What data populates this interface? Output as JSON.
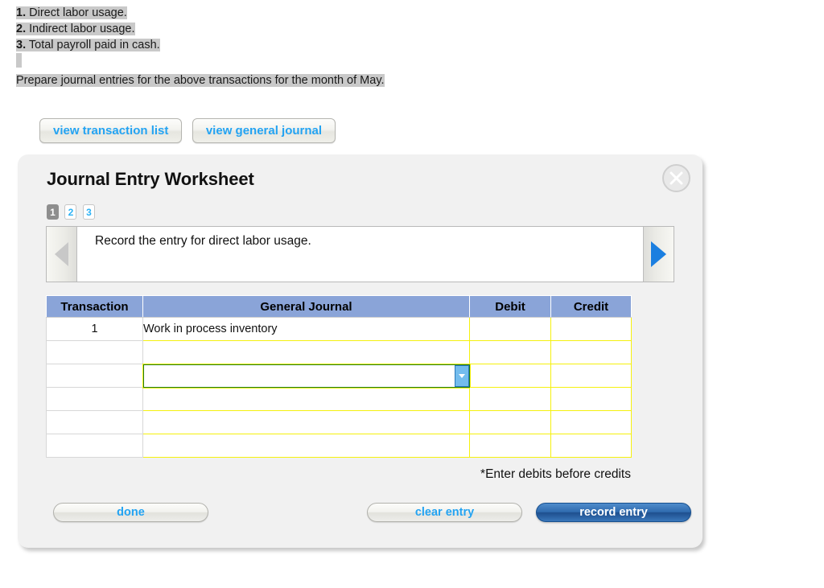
{
  "problem": {
    "items": [
      {
        "num": "1.",
        "text": "Direct labor usage."
      },
      {
        "num": "2.",
        "text": "Indirect labor usage."
      },
      {
        "num": "3.",
        "text": "Total payroll paid in cash."
      }
    ],
    "instruction": "Prepare journal entries for the above transactions for the month of May."
  },
  "view_bar": {
    "transaction_list_label": "view transaction list",
    "general_journal_label": "view general journal"
  },
  "panel": {
    "title": "Journal Entry Worksheet",
    "close_icon": "close-icon",
    "steps": [
      {
        "label": "1",
        "active": true
      },
      {
        "label": "2",
        "active": false
      },
      {
        "label": "3",
        "active": false
      }
    ],
    "prompt": {
      "prev_icon": "arrow-left-icon",
      "next_icon": "arrow-right-icon",
      "text": "Record the entry for direct labor usage."
    },
    "table": {
      "headers": [
        "Transaction",
        "General Journal",
        "Debit",
        "Credit"
      ],
      "rows": [
        {
          "transaction": "1",
          "general_journal": "Work in process inventory",
          "debit": "",
          "credit": "",
          "selected": false
        },
        {
          "transaction": "",
          "general_journal": "",
          "debit": "",
          "credit": "",
          "selected": false
        },
        {
          "transaction": "",
          "general_journal": "",
          "debit": "",
          "credit": "",
          "selected": true
        },
        {
          "transaction": "",
          "general_journal": "",
          "debit": "",
          "credit": "",
          "selected": false
        },
        {
          "transaction": "",
          "general_journal": "",
          "debit": "",
          "credit": "",
          "selected": false
        },
        {
          "transaction": "",
          "general_journal": "",
          "debit": "",
          "credit": "",
          "selected": false
        }
      ]
    },
    "note": "*Enter debits before credits",
    "buttons": {
      "done": "done",
      "clear_entry": "clear entry",
      "record_entry": "record entry"
    }
  },
  "colors": {
    "accent_blue": "#23a3f2",
    "header_blue": "#8aa4d8",
    "cell_border_yellow": "#f5f10d",
    "selected_green": "#1e7a1e",
    "primary_button": "#2f6aae",
    "highlight_gray": "#c9c9c9"
  }
}
